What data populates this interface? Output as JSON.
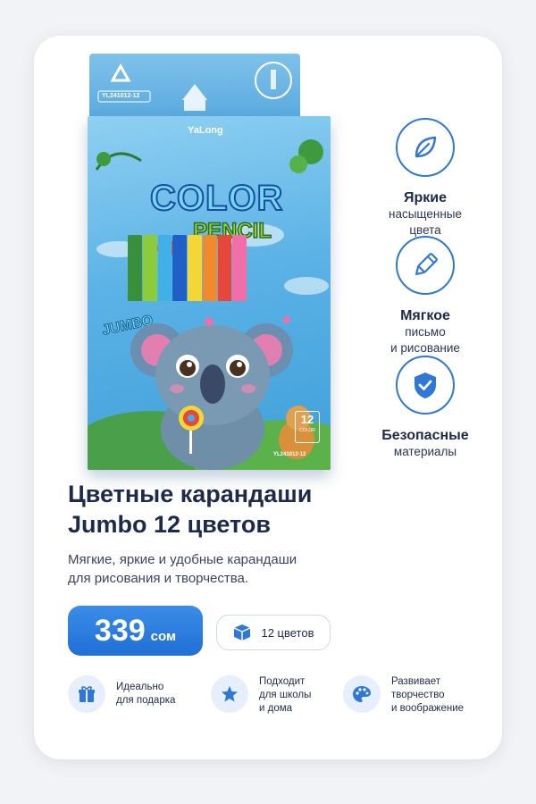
{
  "product": {
    "brand": "YaLong",
    "logo_line1": "COLOR",
    "logo_line2": "PENCIL",
    "jumbo": "JUMBO",
    "sku": "YL241012-12",
    "badge_num": "12",
    "badge_text": "COLOR",
    "pencil_colors": [
      "#3a8f3a",
      "#8ccc3c",
      "#3fb0e8",
      "#1f5fc8",
      "#f4d637",
      "#f08a2c",
      "#e8463a",
      "#f06fa8"
    ]
  },
  "features": [
    {
      "icon": "leaf-icon",
      "title": "Яркие",
      "lines": [
        "насыщенные",
        "цвета"
      ]
    },
    {
      "icon": "pencil-icon",
      "title": "Мягкое",
      "lines": [
        "письмо",
        "и рисование"
      ]
    },
    {
      "icon": "shield-check-icon",
      "title": "Безопасные",
      "lines": [
        "материалы"
      ]
    }
  ],
  "title": {
    "line1": "Цветные карандаши",
    "line2": "Jumbo 12 цветов"
  },
  "subtitle": {
    "line1": "Мягкие, яркие и удобные карандаши",
    "line2": "для рисования и творчества."
  },
  "price": {
    "value": "339",
    "currency": "сом"
  },
  "count_label": "12 цветов",
  "benefits": [
    {
      "icon": "gift-icon",
      "lines": [
        "Идеально",
        "для подарка"
      ]
    },
    {
      "icon": "star-icon",
      "lines": [
        "Подходит",
        "для школы",
        "и дома"
      ]
    },
    {
      "icon": "palette-icon",
      "lines": [
        "Развивает",
        "творчество",
        "и воображение"
      ]
    }
  ],
  "colors": {
    "accent": "#2f78d6",
    "text": "#1e2a4a",
    "benefit_bg": "#e6effb"
  }
}
